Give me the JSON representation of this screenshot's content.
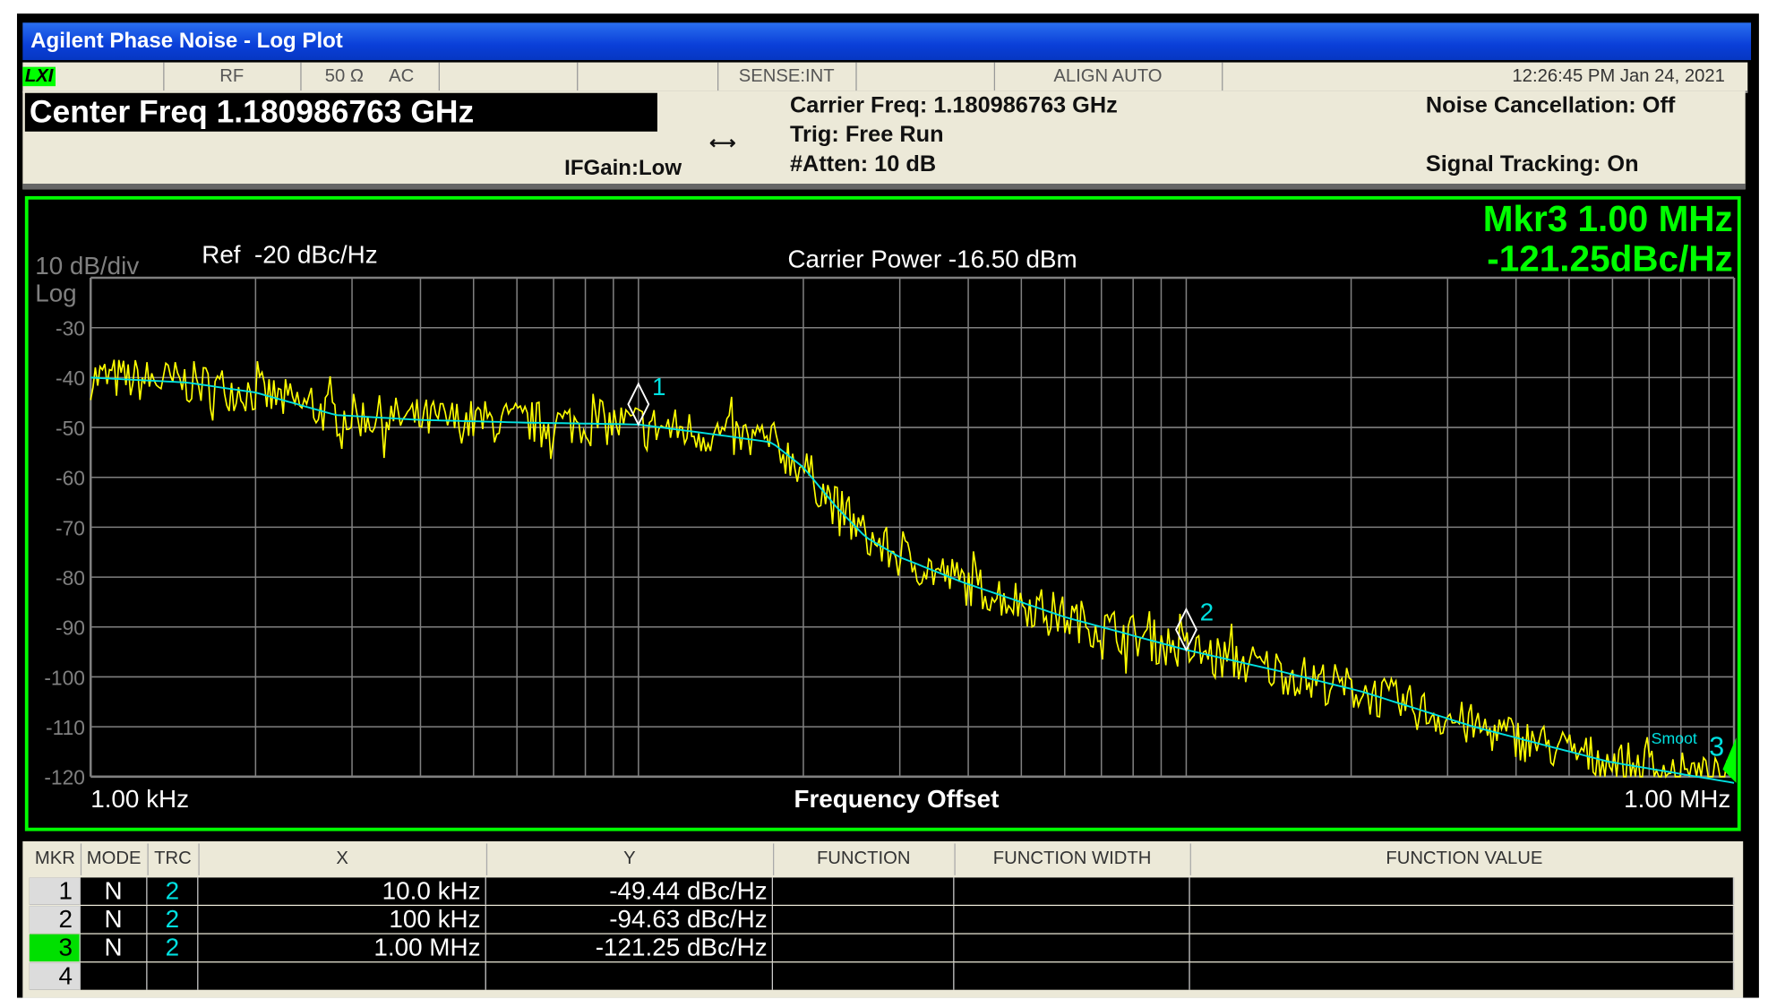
{
  "window": {
    "title": "Agilent Phase Noise - Log Plot"
  },
  "status_bar": {
    "lxi": "LXI",
    "rf": "RF",
    "impedance": "50 Ω",
    "coupling": "AC",
    "sense": "SENSE:INT",
    "align": "ALIGN AUTO",
    "datetime": "12:26:45 PM Jan 24, 2021"
  },
  "info": {
    "center_freq": "Center Freq 1.180986763 GHz",
    "ifgain": "IFGain:Low",
    "carrier_freq": "Carrier Freq: 1.180986763 GHz",
    "trig": "Trig: Free Run",
    "atten": "#Atten: 10 dB",
    "noise_cancel": "Noise Cancellation: Off",
    "signal_tracking": "Signal Tracking: On"
  },
  "colors": {
    "trace_raw": "#ffff00",
    "trace_smooth": "#00e0e0",
    "border": "#00ff00",
    "grid": "#808080"
  },
  "chart_data": {
    "type": "line",
    "scale_label": "10 dB/div",
    "scale_type": "Log",
    "ref_label": "Ref  -20 dBc/Hz",
    "carrier_power": "Carrier Power -16.50 dBm",
    "marker_readout": {
      "line1": "Mkr3 1.00 MHz",
      "line2": "-121.25dBc/Hz"
    },
    "xlabel": "Frequency Offset",
    "x_start_label": "1.00 kHz",
    "x_stop_label": "1.00 MHz",
    "xlim_hz": [
      1000,
      1000000
    ],
    "ylim": [
      -120,
      -20
    ],
    "yticks": [
      "-30",
      "-40",
      "-50",
      "-60",
      "-70",
      "-80",
      "-90",
      "-100",
      "-110",
      "-120"
    ],
    "smoothing_label": "Smoot",
    "smoothed_trace": [
      [
        1000,
        -40
      ],
      [
        1500,
        -41
      ],
      [
        2000,
        -43
      ],
      [
        2800,
        -47.5
      ],
      [
        4000,
        -48.5
      ],
      [
        6000,
        -49
      ],
      [
        10000,
        -49.4
      ],
      [
        14000,
        -51.5
      ],
      [
        17500,
        -53
      ],
      [
        20000,
        -58
      ],
      [
        23000,
        -66
      ],
      [
        26000,
        -72
      ],
      [
        30000,
        -76
      ],
      [
        39000,
        -81
      ],
      [
        60000,
        -88
      ],
      [
        100000,
        -94.6
      ],
      [
        150000,
        -99
      ],
      [
        210000,
        -103
      ],
      [
        335000,
        -110
      ],
      [
        590000,
        -117
      ],
      [
        1000000,
        -121.25
      ]
    ],
    "markers": [
      {
        "n": "1",
        "x_hz": 10000,
        "y": -49.44
      },
      {
        "n": "2",
        "x_hz": 100000,
        "y": -94.63
      },
      {
        "n": "3",
        "x_hz": 1000000,
        "y": -121.25
      }
    ]
  },
  "table": {
    "headers": [
      "MKR",
      "MODE",
      "TRC",
      "X",
      "Y",
      "FUNCTION",
      "FUNCTION WIDTH",
      "FUNCTION VALUE"
    ],
    "rows": [
      {
        "mkr": "1",
        "mode": "N",
        "trc": "2",
        "x": "10.0 kHz",
        "y": "-49.44 dBc/Hz"
      },
      {
        "mkr": "2",
        "mode": "N",
        "trc": "2",
        "x": "100 kHz",
        "y": "-94.63 dBc/Hz"
      },
      {
        "mkr": "3",
        "mode": "N",
        "trc": "2",
        "x": "1.00 MHz",
        "y": "-121.25 dBc/Hz"
      },
      {
        "mkr": "4",
        "mode": "",
        "trc": "",
        "x": "",
        "y": ""
      }
    ]
  }
}
